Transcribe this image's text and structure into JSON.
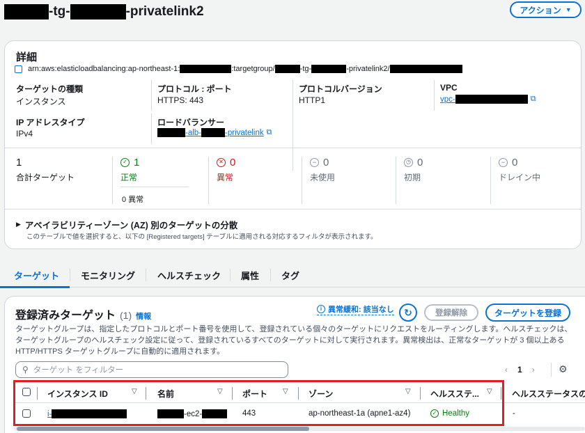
{
  "header": {
    "title_suffix_1": "-tg-",
    "title_suffix_2": "-privatelink2",
    "actions_button": "アクション"
  },
  "details": {
    "heading": "詳細",
    "arn_prefix": "arn:aws:elasticloadbalancing:ap-northeast-1:",
    "arn_part2": ":targetgroup/",
    "arn_part3": "-tg-",
    "arn_part4": "-privatelink2/",
    "target_type_label": "ターゲットの種類",
    "target_type_value": "インスタンス",
    "protocol_port_label": "プロトコル : ポート",
    "protocol_port_value": "HTTPS: 443",
    "protocol_version_label": "プロトコルバージョン",
    "protocol_version_value": "HTTP1",
    "vpc_label": "VPC",
    "vpc_value_prefix": "vpc-",
    "ip_type_label": "IP アドレスタイプ",
    "ip_type_value": "IPv4",
    "lb_label": "ロードバランサー",
    "lb_part1": "-alb-",
    "lb_part2": "-privatelink"
  },
  "stats": [
    {
      "value": "1",
      "label": "合計ターゲット",
      "color": "#16191f"
    },
    {
      "value": "1",
      "label": "正常",
      "color": "#037f0c",
      "sub": "0 異常"
    },
    {
      "value": "0",
      "label": "異常",
      "color": "#d91515"
    },
    {
      "value": "0",
      "label": "未使用",
      "color": "#5f6b7a"
    },
    {
      "value": "0",
      "label": "初期",
      "color": "#5f6b7a"
    },
    {
      "value": "0",
      "label": "ドレイン中",
      "color": "#5f6b7a"
    }
  ],
  "az_section": {
    "title": "アベイラビリティーゾーン (AZ) 別のターゲットの分散",
    "description": "このテーブルで値を選択すると、以下の [Registered targets] テーブルに適用される対応するフィルタが表示されます。"
  },
  "tabs": [
    "ターゲット",
    "モニタリング",
    "ヘルスチェック",
    "属性",
    "タグ"
  ],
  "registered": {
    "title": "登録済みターゲット",
    "count": "(1)",
    "info": "情報",
    "anomaly_label": "異常緩和: 該当なし",
    "deregister_button": "登録解除",
    "register_button": "ターゲットを登録",
    "description": "ターゲットグループは、指定したプロトコルとポート番号を使用して、登録されている個々のターゲットにリクエストをルーティングします。ヘルスチェックは、ターゲットグループのヘルスチェック設定に従って、登録されているすべてのターゲットに対して実行されます。異常検出は、正常なターゲットが 3 個以上ある HTTP/HTTPS ターゲットグループに自動的に適用されます。",
    "filter_placeholder": "ターゲット をフィルター",
    "page": "1",
    "columns": [
      "インスタンス ID",
      "名前",
      "ポート",
      "ゾーン",
      "ヘルスステ...",
      "ヘルスステータスの"
    ],
    "row": {
      "instance_prefix": "i-",
      "name_part": "-ec2-",
      "port": "443",
      "zone": "ap-northeast-1a (apne1-az4)",
      "health": "Healthy",
      "health_detail": "-"
    }
  },
  "colors": {
    "accent": "#0972d3",
    "success": "#037f0c",
    "error": "#d91515",
    "highlight_box": "#e02020"
  }
}
